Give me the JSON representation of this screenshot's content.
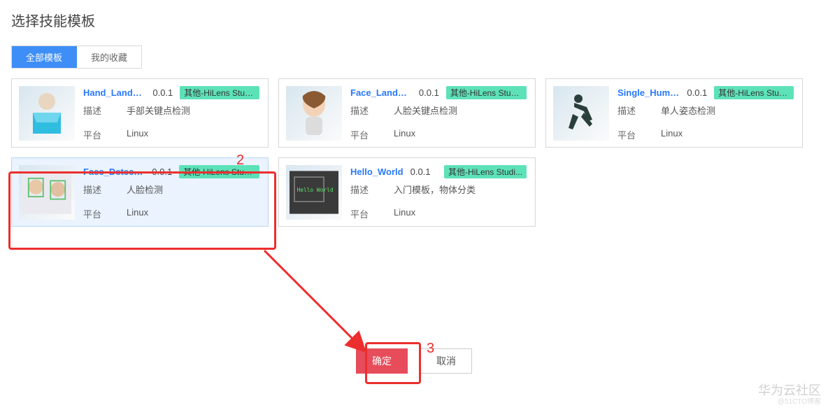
{
  "title": "选择技能模板",
  "tabs": {
    "all": "全部模板",
    "fav": "我的收藏"
  },
  "labels": {
    "desc": "描述",
    "platform": "平台"
  },
  "cards": [
    {
      "name": "Hand_Landm...",
      "version": "0.0.1",
      "tag": "其他-HiLens Studi...",
      "desc": "手部关键点检测",
      "platform": "Linux"
    },
    {
      "name": "Face_Landm...",
      "version": "0.0.1",
      "tag": "其他-HiLens Studi...",
      "desc": "人脸关键点检测",
      "platform": "Linux"
    },
    {
      "name": "Single_Huma...",
      "version": "0.0.1",
      "tag": "其他-HiLens Studi...",
      "desc": "单人姿态检测",
      "platform": "Linux"
    },
    {
      "name": "Face_Detecti...",
      "version": "0.0.1",
      "tag": "其他-HiLens Studi...",
      "desc": "人脸检测",
      "platform": "Linux"
    },
    {
      "name": "Hello_World",
      "version": "0.0.1",
      "tag": "其他-HiLens Studi...",
      "desc": "入门模板，物体分类",
      "platform": "Linux"
    }
  ],
  "buttons": {
    "ok": "确定",
    "cancel": "取消"
  },
  "annotations": {
    "step2": "2",
    "step3": "3"
  },
  "watermark": {
    "main": "华为云社区",
    "sub": "@51CTO博客"
  }
}
